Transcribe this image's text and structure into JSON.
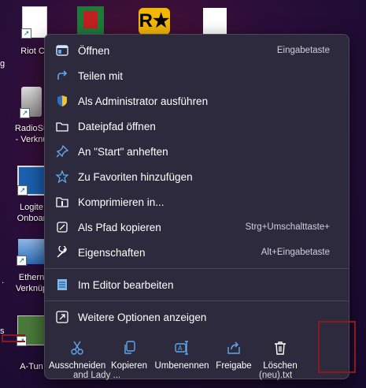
{
  "desktop": {
    "icons": [
      {
        "label": "Riot Cli"
      },
      {
        "label": ""
      },
      {
        "label": ""
      },
      {
        "label": ""
      },
      {
        "label1": "RadioSu",
        "label2": "- Verknü"
      },
      {
        "label1": "Logite",
        "label2": "Onboar"
      },
      {
        "label1": "Ethern",
        "label2": "Verknüp"
      },
      {
        "label": "A-Tun"
      }
    ],
    "left_edge_char_1": "g",
    "left_edge_char_2": ".",
    "left_edge_char_3": "s"
  },
  "context_menu": {
    "items": [
      {
        "label": "Öffnen",
        "shortcut": "Eingabetaste",
        "icon": "open-icon"
      },
      {
        "label": "Teilen mit",
        "shortcut": "",
        "icon": "share-icon"
      },
      {
        "label": "Als Administrator ausführen",
        "shortcut": "",
        "icon": "shield-icon"
      },
      {
        "label": "Dateipfad öffnen",
        "shortcut": "",
        "icon": "folder-icon"
      },
      {
        "label": "An \"Start\" anheften",
        "shortcut": "",
        "icon": "pin-icon"
      },
      {
        "label": "Zu Favoriten hinzufügen",
        "shortcut": "",
        "icon": "star-icon"
      },
      {
        "label": "Komprimieren in...",
        "shortcut": "",
        "icon": "zip-icon"
      },
      {
        "label": "Als Pfad kopieren",
        "shortcut": "Strg+Umschalttaste+",
        "icon": "copy-path-icon"
      },
      {
        "label": "Eigenschaften",
        "shortcut": "Alt+Eingabetaste",
        "icon": "wrench-icon"
      },
      {
        "label": "Im Editor bearbeiten",
        "shortcut": "",
        "icon": "notepad-icon"
      },
      {
        "label": "Weitere Optionen anzeigen",
        "shortcut": "",
        "icon": "more-options-icon"
      }
    ],
    "bottom_bar": [
      {
        "label": "Ausschneiden",
        "icon": "scissors-icon"
      },
      {
        "label": "Kopieren",
        "icon": "copy-icon"
      },
      {
        "label": "Umbenennen",
        "icon": "rename-icon"
      },
      {
        "label": "Freigabe",
        "icon": "share-icon"
      },
      {
        "label": "Löschen",
        "icon": "trash-icon"
      }
    ],
    "underlap_text_1": "and Lady ...",
    "underlap_text_2": "(neu).txt"
  },
  "colors": {
    "menu_bg": "#2c2a3c",
    "icon_blue": "#60a8f0",
    "highlight_box": "#8b1a1a"
  }
}
